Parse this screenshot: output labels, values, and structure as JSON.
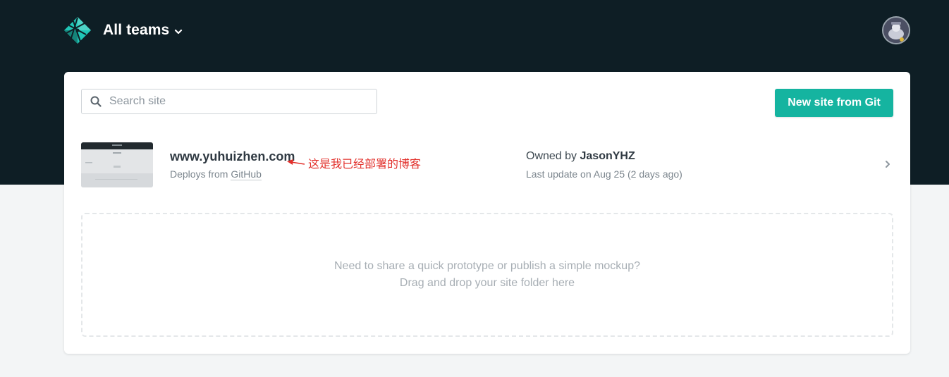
{
  "header": {
    "logo_icon": "netlify-logo-icon",
    "team_selector": {
      "label": "All teams",
      "icon": "chevron-down-icon"
    },
    "avatar": "user-avatar",
    "colors": {
      "background": "#0e1e25",
      "accent": "#15b4a0"
    }
  },
  "toolbar": {
    "search": {
      "placeholder": "Search site",
      "value": "",
      "icon": "search-icon"
    },
    "new_site_label": "New site from Git"
  },
  "sites": [
    {
      "name": "www.yuhuizhen.com",
      "deploys_prefix": "Deploys from",
      "deploy_source": "GitHub",
      "owner_prefix": "Owned by",
      "owner": "JasonYHZ",
      "last_update": "Last update on Aug 25 (2 days ago)",
      "annotation": "这是我已经部署的博客"
    }
  ],
  "dropzone": {
    "line1": "Need to share a quick prototype or publish a simple mockup?",
    "line2": "Drag and drop your site folder here"
  }
}
